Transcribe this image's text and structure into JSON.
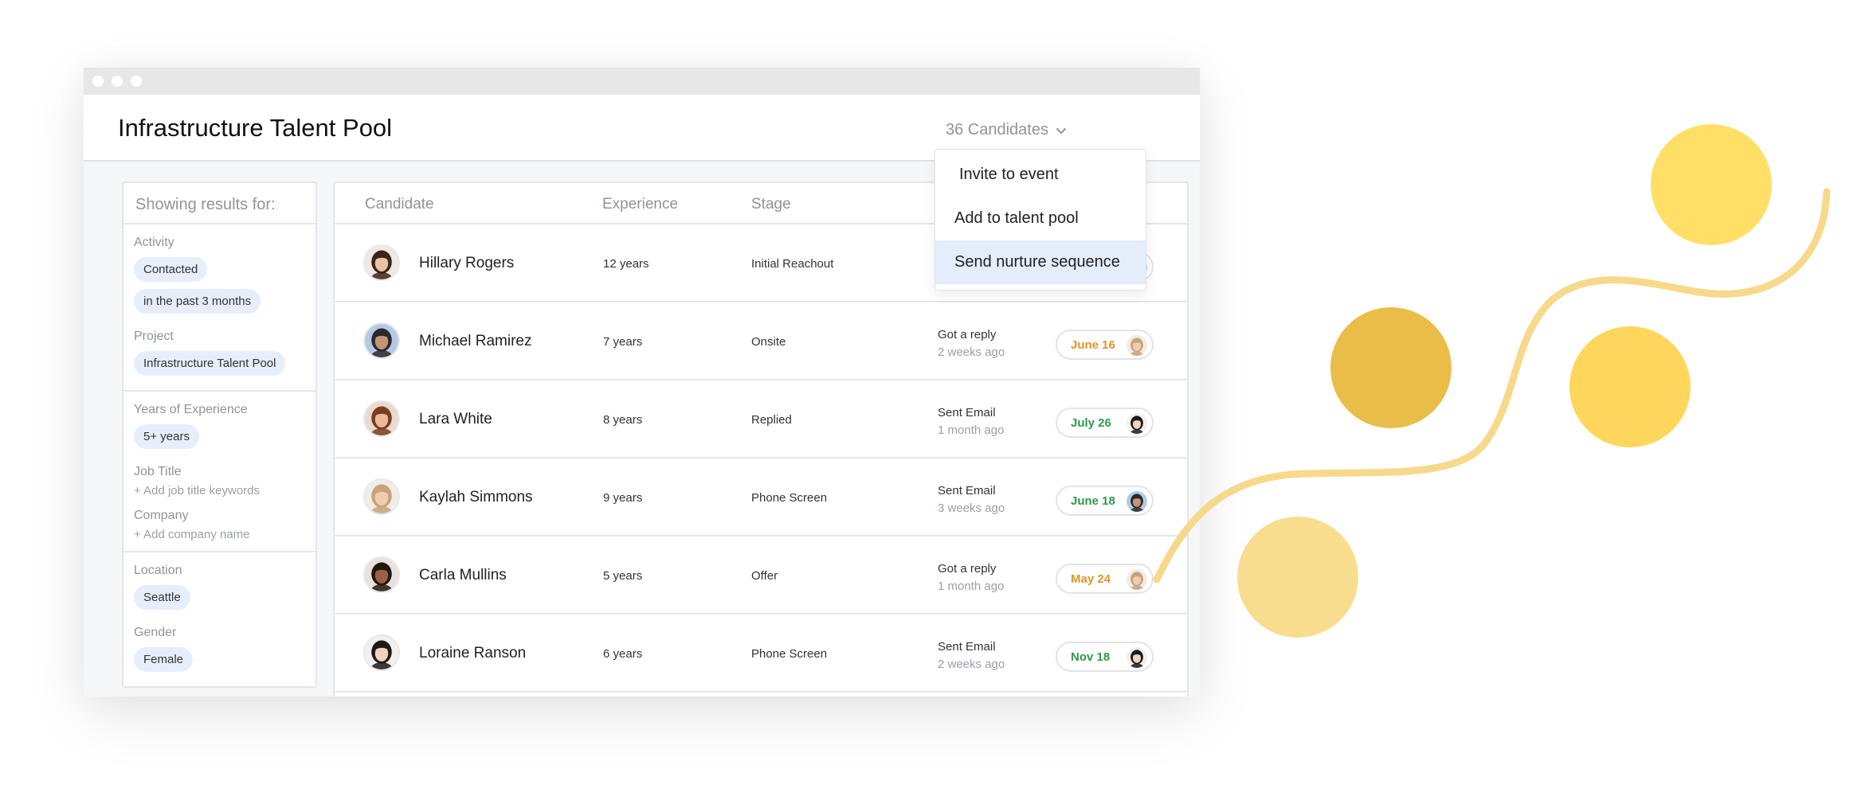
{
  "window": {
    "controls": [
      "close",
      "minimize",
      "maximize"
    ]
  },
  "header": {
    "title": "Infrastructure Talent Pool",
    "candidates_label": "36 Candidates",
    "chevron_icon": "chevron-down-icon"
  },
  "menu": {
    "items": [
      {
        "label": "Invite to event",
        "active": false
      },
      {
        "label": "Add to talent pool",
        "active": false
      },
      {
        "label": "Send nurture sequence",
        "active": true
      }
    ]
  },
  "filters": {
    "heading": "Showing results for:",
    "activity": {
      "label": "Activity",
      "chips": [
        "Contacted",
        "in the past 3 months"
      ]
    },
    "project": {
      "label": "Project",
      "chips": [
        "Infrastructure Talent Pool"
      ]
    },
    "years": {
      "label": "Years of Experience",
      "chips": [
        "5+ years"
      ]
    },
    "job_title": {
      "label": "Job Title",
      "add": "+ Add job title keywords"
    },
    "company": {
      "label": "Company",
      "add": "+ Add company name"
    },
    "location": {
      "label": "Location",
      "chips": [
        "Seattle"
      ]
    },
    "gender": {
      "label": "Gender",
      "chips": [
        "Female"
      ]
    }
  },
  "table": {
    "columns": [
      "Candidate",
      "Experience",
      "Stage"
    ],
    "rows": [
      {
        "name": "Hillary Rogers",
        "experience": "12 years",
        "stage": "Initial Reachout",
        "activity": "",
        "activity_time": "",
        "date": "",
        "date_color": "#2e9a48"
      },
      {
        "name": "Michael Ramirez",
        "experience": "7 years",
        "stage": "Onsite",
        "activity": "Got a reply",
        "activity_time": "2 weeks ago",
        "date": "June 16",
        "date_color": "#e0952a"
      },
      {
        "name": "Lara White",
        "experience": "8 years",
        "stage": "Replied",
        "activity": "Sent Email",
        "activity_time": "1 month ago",
        "date": "July 26",
        "date_color": "#2e9a48"
      },
      {
        "name": "Kaylah Simmons",
        "experience": "9 years",
        "stage": "Phone Screen",
        "activity": "Sent Email",
        "activity_time": "3 weeks ago",
        "date": "June 18",
        "date_color": "#2e9a48"
      },
      {
        "name": "Carla Mullins",
        "experience": "5 years",
        "stage": "Offer",
        "activity": "Got a reply",
        "activity_time": "1 month ago",
        "date": "May 24",
        "date_color": "#e0952a"
      },
      {
        "name": "Loraine Ranson",
        "experience": "6 years",
        "stage": "Phone Screen",
        "activity": "Sent Email",
        "activity_time": "2 weeks ago",
        "date": "Nov 18",
        "date_color": "#2e9a48"
      }
    ]
  },
  "colors": {
    "accent_highlight": "#e4edfb",
    "chip_bg": "#e6eefb",
    "deco_yellow_light": "#f9dd8f",
    "deco_yellow": "#ffd65c",
    "deco_yellow_bright": "#ffdf66",
    "deco_gold": "#e9bd48"
  }
}
